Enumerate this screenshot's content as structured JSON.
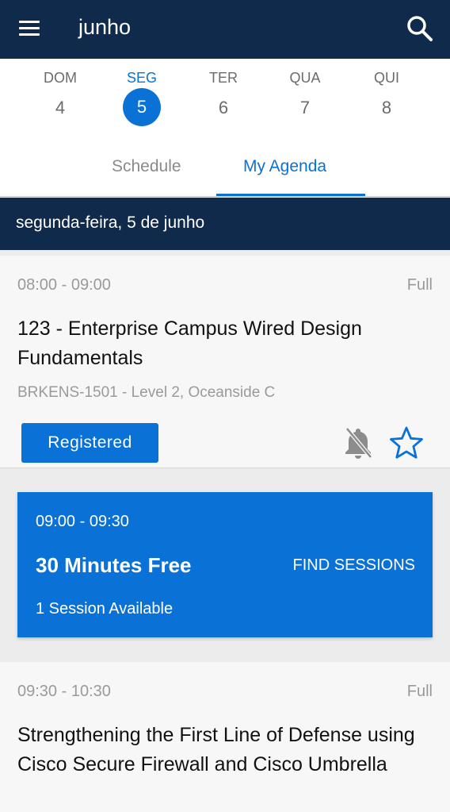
{
  "appbar": {
    "title": "junho"
  },
  "days": [
    {
      "name": "DOM",
      "num": "4"
    },
    {
      "name": "SEG",
      "num": "5"
    },
    {
      "name": "TER",
      "num": "6"
    },
    {
      "name": "QUA",
      "num": "7"
    },
    {
      "name": "QUI",
      "num": "8"
    }
  ],
  "selected_day": "SEG",
  "tabs": {
    "schedule": "Schedule",
    "agenda": "My Agenda",
    "active": "My Agenda"
  },
  "date_header": "segunda-feira, 5 de junho",
  "sessions": [
    {
      "time": "08:00 - 09:00",
      "status": "Full",
      "title": "123 - Enterprise Campus Wired Design Fundamentals",
      "meta": "BRKENS-1501 - Level 2, Oceanside C",
      "button": "Registered"
    },
    {
      "time": "09:30 - 10:30",
      "status": "Full",
      "title": "Strengthening the First Line of Defense using Cisco Secure Firewall and Cisco Umbrella"
    }
  ],
  "free_slot": {
    "time": "09:00 - 09:30",
    "title": "30 Minutes Free",
    "action": "FIND SESSIONS",
    "available": "1 Session Available"
  },
  "colors": {
    "navy": "#102a4c",
    "accent": "#0a72d6"
  },
  "icons": {
    "menu": "menu-icon",
    "search": "search-icon",
    "bell": "bell-off-icon",
    "star": "star-outline-icon"
  }
}
